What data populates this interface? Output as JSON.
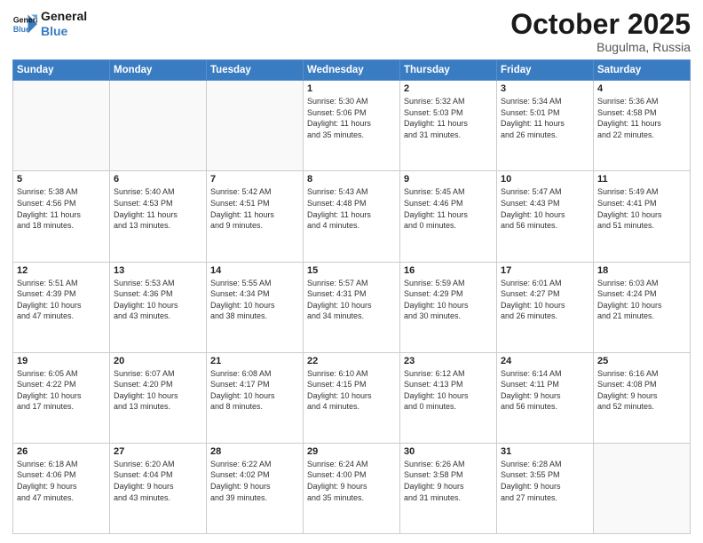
{
  "header": {
    "logo_line1": "General",
    "logo_line2": "Blue",
    "month": "October 2025",
    "location": "Bugulma, Russia"
  },
  "days_of_week": [
    "Sunday",
    "Monday",
    "Tuesday",
    "Wednesday",
    "Thursday",
    "Friday",
    "Saturday"
  ],
  "weeks": [
    [
      {
        "day": "",
        "info": ""
      },
      {
        "day": "",
        "info": ""
      },
      {
        "day": "",
        "info": ""
      },
      {
        "day": "1",
        "info": "Sunrise: 5:30 AM\nSunset: 5:06 PM\nDaylight: 11 hours\nand 35 minutes."
      },
      {
        "day": "2",
        "info": "Sunrise: 5:32 AM\nSunset: 5:03 PM\nDaylight: 11 hours\nand 31 minutes."
      },
      {
        "day": "3",
        "info": "Sunrise: 5:34 AM\nSunset: 5:01 PM\nDaylight: 11 hours\nand 26 minutes."
      },
      {
        "day": "4",
        "info": "Sunrise: 5:36 AM\nSunset: 4:58 PM\nDaylight: 11 hours\nand 22 minutes."
      }
    ],
    [
      {
        "day": "5",
        "info": "Sunrise: 5:38 AM\nSunset: 4:56 PM\nDaylight: 11 hours\nand 18 minutes."
      },
      {
        "day": "6",
        "info": "Sunrise: 5:40 AM\nSunset: 4:53 PM\nDaylight: 11 hours\nand 13 minutes."
      },
      {
        "day": "7",
        "info": "Sunrise: 5:42 AM\nSunset: 4:51 PM\nDaylight: 11 hours\nand 9 minutes."
      },
      {
        "day": "8",
        "info": "Sunrise: 5:43 AM\nSunset: 4:48 PM\nDaylight: 11 hours\nand 4 minutes."
      },
      {
        "day": "9",
        "info": "Sunrise: 5:45 AM\nSunset: 4:46 PM\nDaylight: 11 hours\nand 0 minutes."
      },
      {
        "day": "10",
        "info": "Sunrise: 5:47 AM\nSunset: 4:43 PM\nDaylight: 10 hours\nand 56 minutes."
      },
      {
        "day": "11",
        "info": "Sunrise: 5:49 AM\nSunset: 4:41 PM\nDaylight: 10 hours\nand 51 minutes."
      }
    ],
    [
      {
        "day": "12",
        "info": "Sunrise: 5:51 AM\nSunset: 4:39 PM\nDaylight: 10 hours\nand 47 minutes."
      },
      {
        "day": "13",
        "info": "Sunrise: 5:53 AM\nSunset: 4:36 PM\nDaylight: 10 hours\nand 43 minutes."
      },
      {
        "day": "14",
        "info": "Sunrise: 5:55 AM\nSunset: 4:34 PM\nDaylight: 10 hours\nand 38 minutes."
      },
      {
        "day": "15",
        "info": "Sunrise: 5:57 AM\nSunset: 4:31 PM\nDaylight: 10 hours\nand 34 minutes."
      },
      {
        "day": "16",
        "info": "Sunrise: 5:59 AM\nSunset: 4:29 PM\nDaylight: 10 hours\nand 30 minutes."
      },
      {
        "day": "17",
        "info": "Sunrise: 6:01 AM\nSunset: 4:27 PM\nDaylight: 10 hours\nand 26 minutes."
      },
      {
        "day": "18",
        "info": "Sunrise: 6:03 AM\nSunset: 4:24 PM\nDaylight: 10 hours\nand 21 minutes."
      }
    ],
    [
      {
        "day": "19",
        "info": "Sunrise: 6:05 AM\nSunset: 4:22 PM\nDaylight: 10 hours\nand 17 minutes."
      },
      {
        "day": "20",
        "info": "Sunrise: 6:07 AM\nSunset: 4:20 PM\nDaylight: 10 hours\nand 13 minutes."
      },
      {
        "day": "21",
        "info": "Sunrise: 6:08 AM\nSunset: 4:17 PM\nDaylight: 10 hours\nand 8 minutes."
      },
      {
        "day": "22",
        "info": "Sunrise: 6:10 AM\nSunset: 4:15 PM\nDaylight: 10 hours\nand 4 minutes."
      },
      {
        "day": "23",
        "info": "Sunrise: 6:12 AM\nSunset: 4:13 PM\nDaylight: 10 hours\nand 0 minutes."
      },
      {
        "day": "24",
        "info": "Sunrise: 6:14 AM\nSunset: 4:11 PM\nDaylight: 9 hours\nand 56 minutes."
      },
      {
        "day": "25",
        "info": "Sunrise: 6:16 AM\nSunset: 4:08 PM\nDaylight: 9 hours\nand 52 minutes."
      }
    ],
    [
      {
        "day": "26",
        "info": "Sunrise: 6:18 AM\nSunset: 4:06 PM\nDaylight: 9 hours\nand 47 minutes."
      },
      {
        "day": "27",
        "info": "Sunrise: 6:20 AM\nSunset: 4:04 PM\nDaylight: 9 hours\nand 43 minutes."
      },
      {
        "day": "28",
        "info": "Sunrise: 6:22 AM\nSunset: 4:02 PM\nDaylight: 9 hours\nand 39 minutes."
      },
      {
        "day": "29",
        "info": "Sunrise: 6:24 AM\nSunset: 4:00 PM\nDaylight: 9 hours\nand 35 minutes."
      },
      {
        "day": "30",
        "info": "Sunrise: 6:26 AM\nSunset: 3:58 PM\nDaylight: 9 hours\nand 31 minutes."
      },
      {
        "day": "31",
        "info": "Sunrise: 6:28 AM\nSunset: 3:55 PM\nDaylight: 9 hours\nand 27 minutes."
      },
      {
        "day": "",
        "info": ""
      }
    ]
  ]
}
